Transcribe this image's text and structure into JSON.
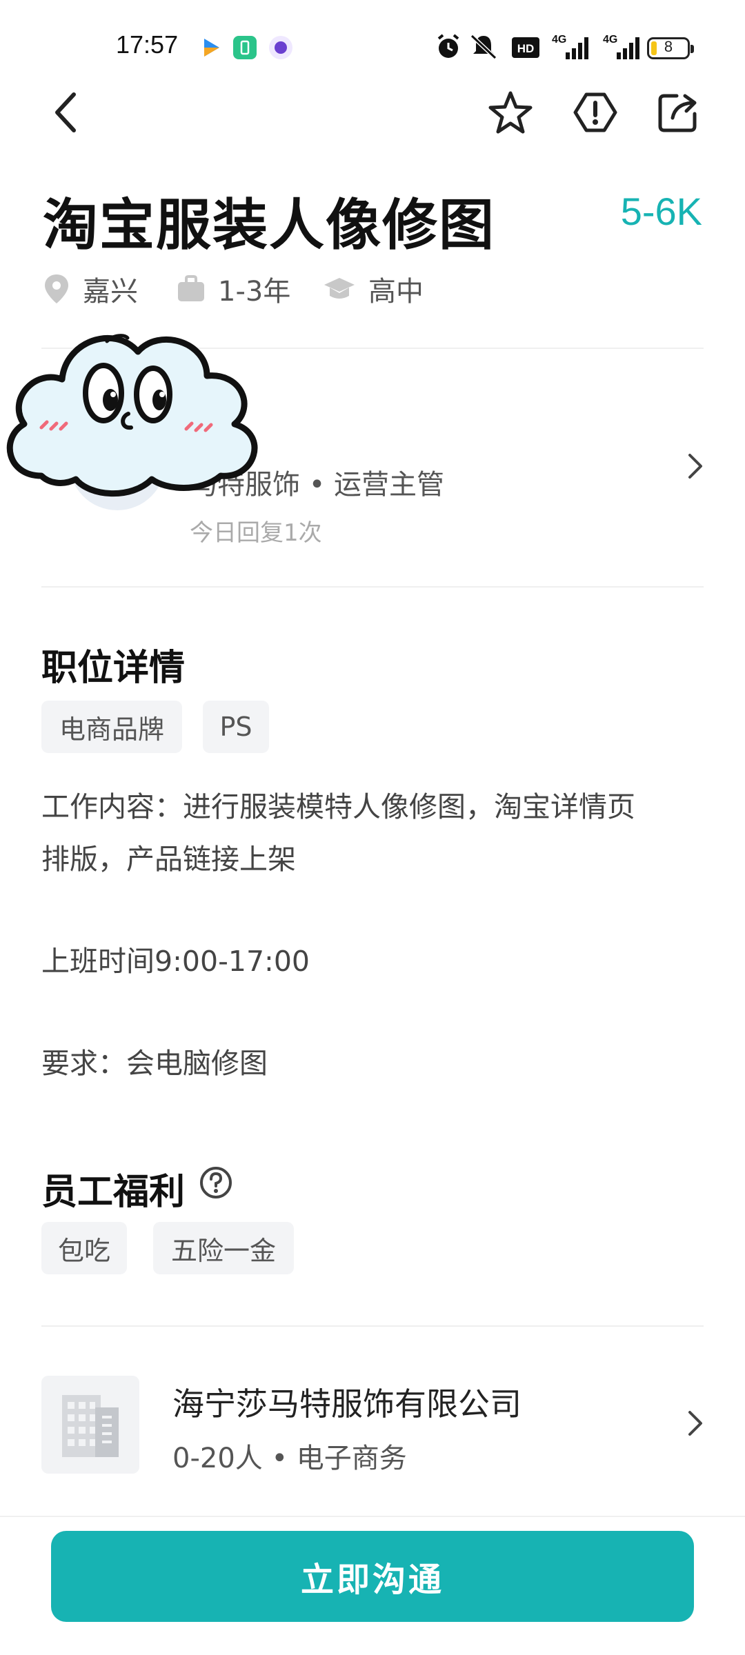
{
  "status_bar": {
    "time": "17:57",
    "network": "4G",
    "network2": "4G",
    "hd": "HD",
    "battery": "8"
  },
  "job": {
    "title": "淘宝服装人像修图",
    "salary": "5-6K",
    "location": "嘉兴",
    "experience": "1-3年",
    "education": "高中"
  },
  "recruiter": {
    "subtitle": "马特服饰 • 运营主管",
    "reply": "今日回复1次"
  },
  "details": {
    "title": "职位详情",
    "tags": [
      "电商品牌",
      "PS"
    ],
    "lines": [
      "工作内容：进行服装模特人像修图，淘宝详情页",
      "排版，产品链接上架",
      "上班时间9:00-17:00",
      "要求：会电脑修图"
    ]
  },
  "benefits": {
    "title": "员工福利",
    "tags": [
      "包吃",
      "五险一金"
    ]
  },
  "company": {
    "name": "海宁莎马特服饰有限公司",
    "info": "0-20人 • 电子商务"
  },
  "action": {
    "chat_label": "立即沟通"
  },
  "colors": {
    "accent": "#17b3b3"
  }
}
